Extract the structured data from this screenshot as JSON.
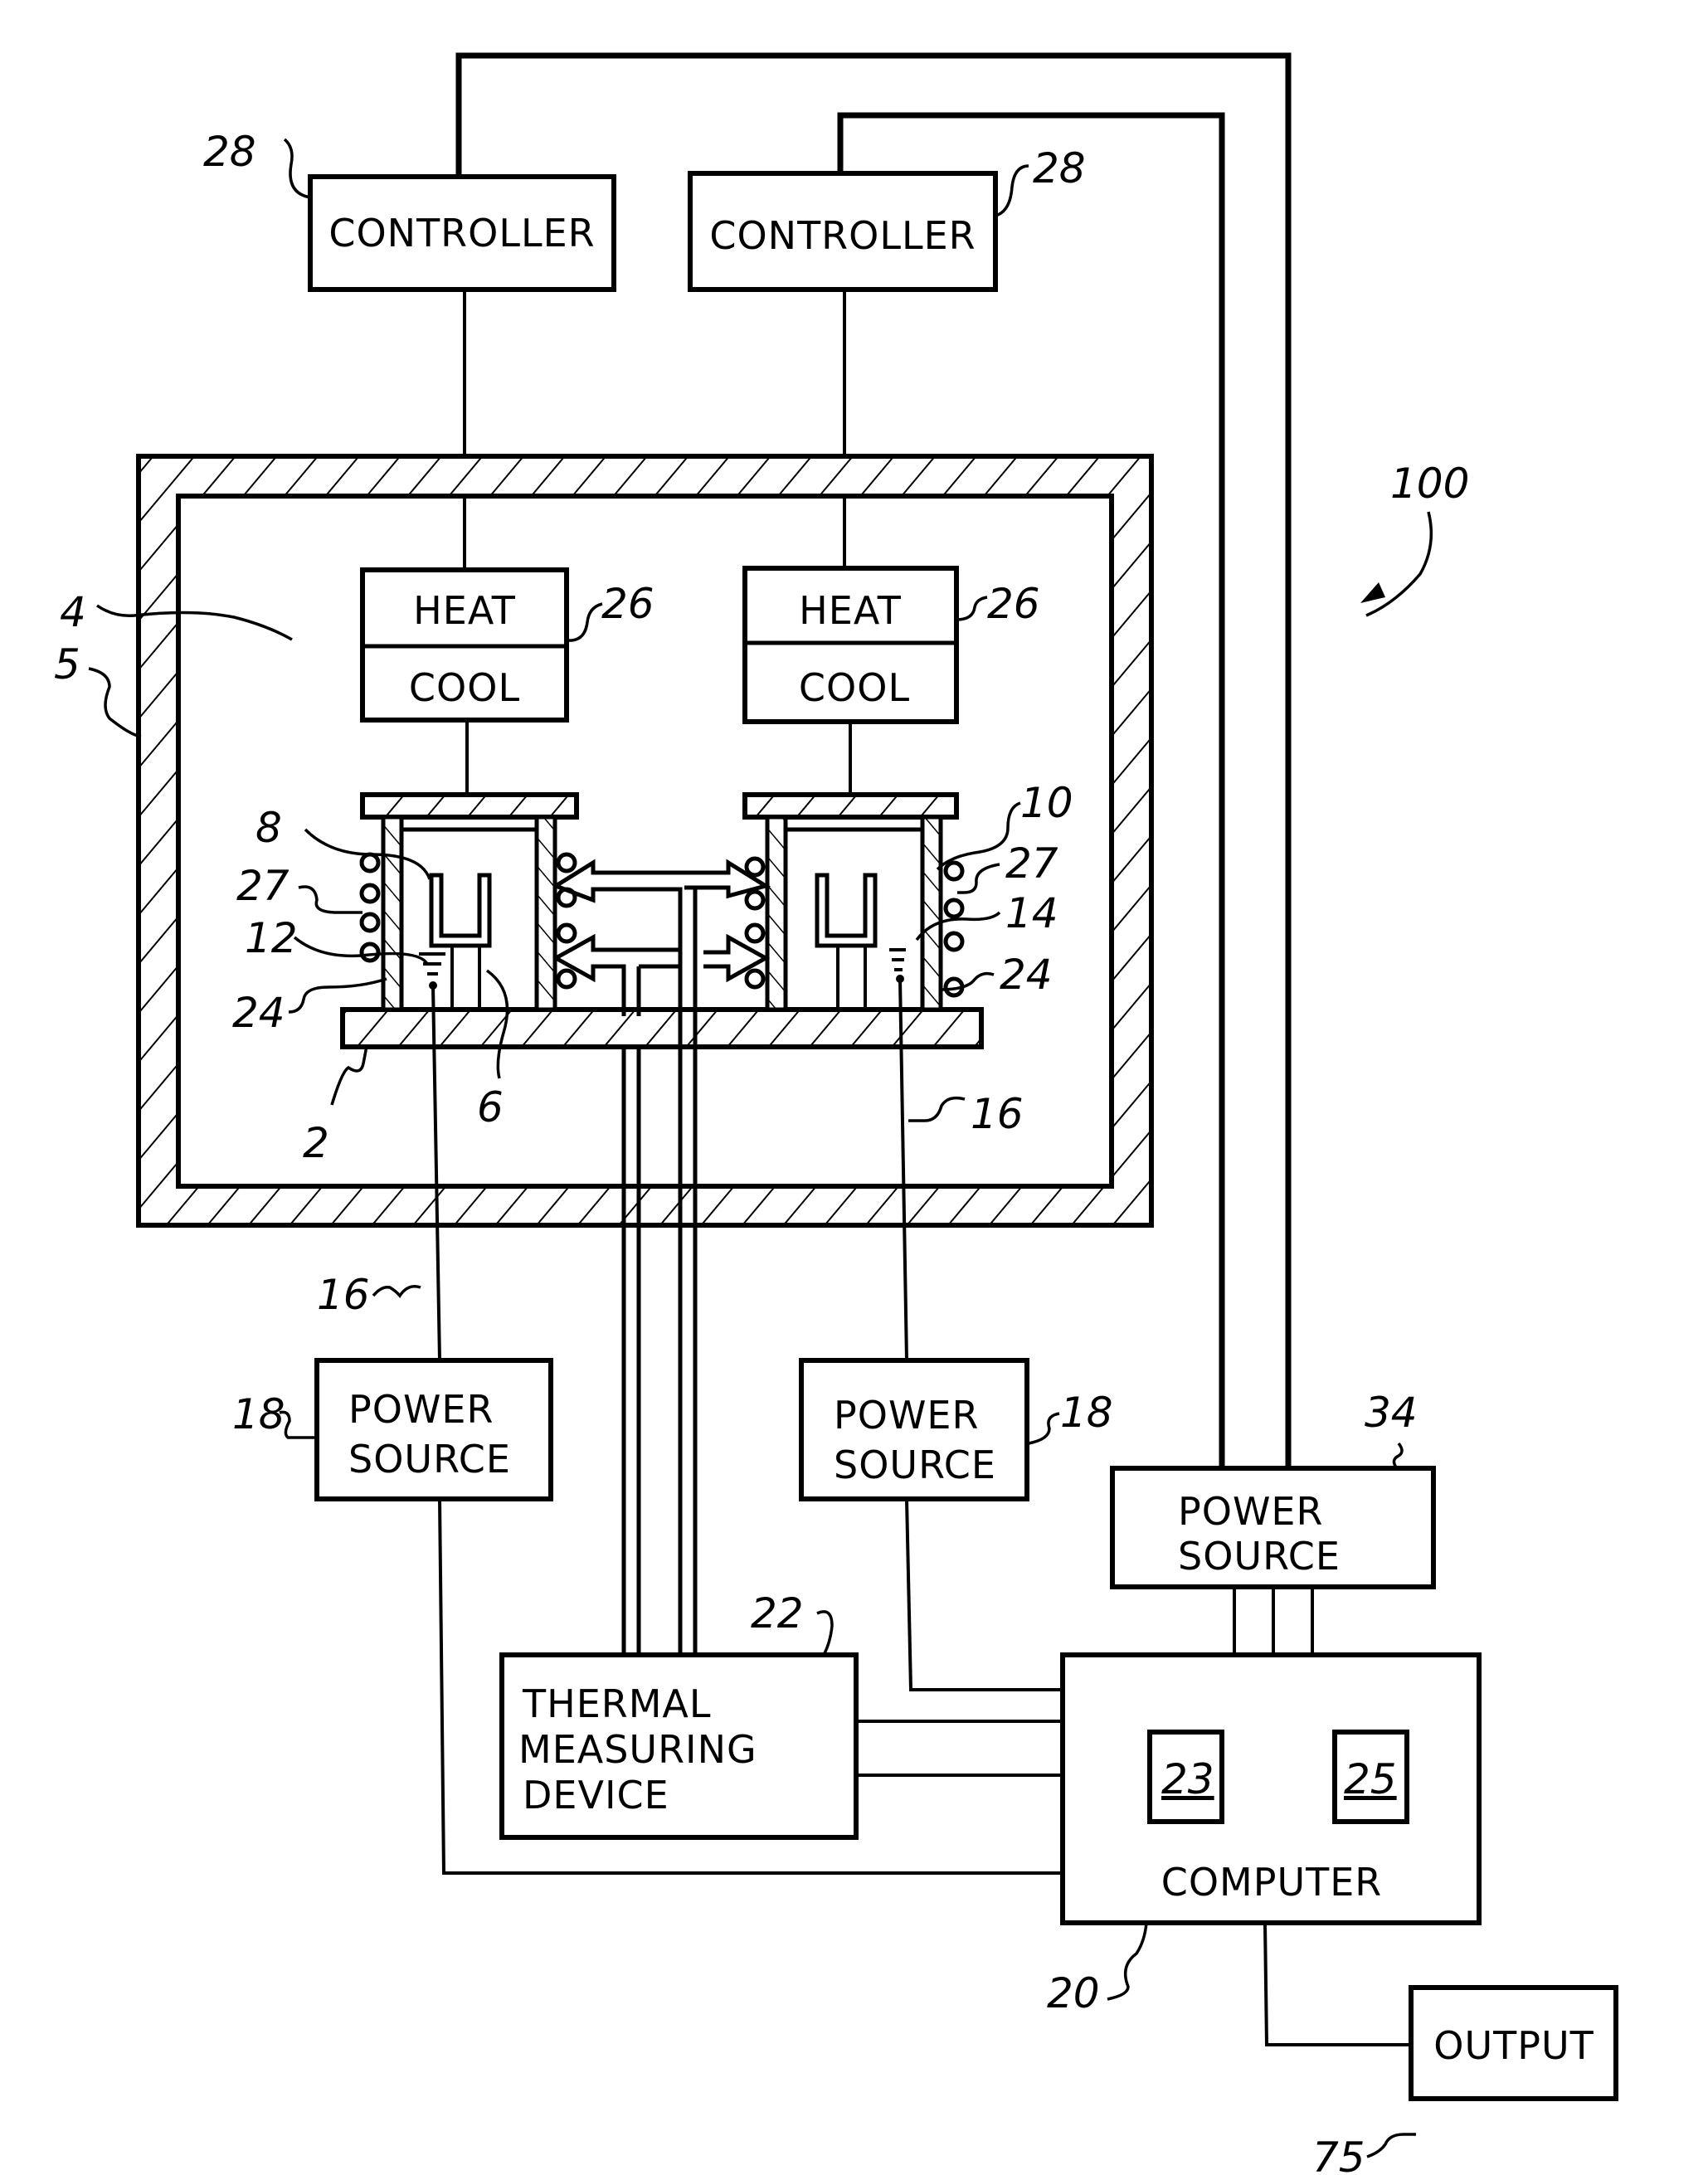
{
  "figure": {
    "reference_number": "100",
    "components": {
      "controller_left": {
        "label": "CONTROLLER",
        "ref": "28"
      },
      "controller_right": {
        "label": "CONTROLLER",
        "ref": "28"
      },
      "heat_cool_left": {
        "heat": "HEAT",
        "cool": "COOL",
        "ref": "26"
      },
      "heat_cool_right": {
        "heat": "HEAT",
        "cool": "COOL",
        "ref": "26"
      },
      "power_source_left": {
        "line1": "POWER",
        "line2": "SOURCE",
        "ref": "18"
      },
      "power_source_right": {
        "line1": "POWER",
        "line2": "SOURCE",
        "ref": "18"
      },
      "power_source_main": {
        "line1": "POWER",
        "line2": "SOURCE",
        "ref": "34"
      },
      "thermal_device": {
        "line1": "THERMAL",
        "line2": "MEASURING",
        "line3": "DEVICE",
        "ref": "22"
      },
      "computer": {
        "label": "COMPUTER",
        "ref": "20",
        "sub_left": "23",
        "sub_right": "25"
      },
      "output": {
        "label": "OUTPUT",
        "ref": "75"
      }
    },
    "part_refs": {
      "chamber": "4",
      "enclosure_wall": "5",
      "crucible_left": "8",
      "crucible_right": "10",
      "coil_left": "27",
      "coil_right": "27",
      "electrode_left": "12",
      "electrode_right": "14",
      "sleeve_left": "24",
      "sleeve_right": "24",
      "base_plate": "2",
      "support": "6",
      "lead_left": "16",
      "lead_right": "16"
    }
  }
}
